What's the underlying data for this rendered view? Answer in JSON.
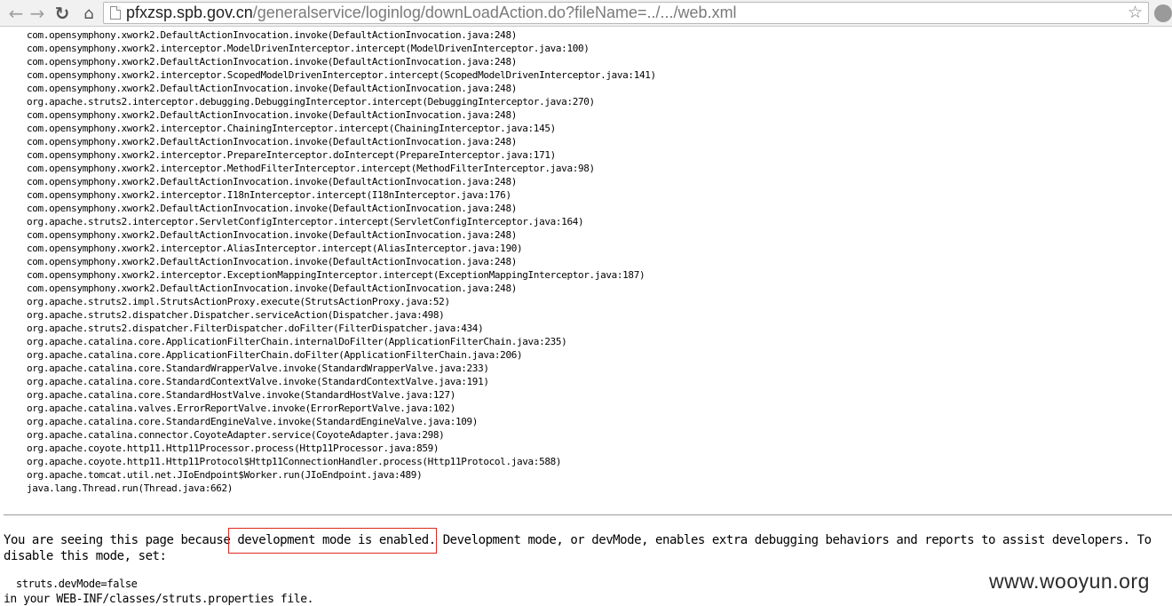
{
  "browser": {
    "url_host": "pfxzsp.spb.gov.cn",
    "url_path": "/generalservice/loginlog/downLoadAction.do?fileName=../.../web.xml"
  },
  "stack_trace": [
    "com.opensymphony.xwork2.DefaultActionInvocation.invoke(DefaultActionInvocation.java:248)",
    "com.opensymphony.xwork2.interceptor.ModelDrivenInterceptor.intercept(ModelDrivenInterceptor.java:100)",
    "com.opensymphony.xwork2.DefaultActionInvocation.invoke(DefaultActionInvocation.java:248)",
    "com.opensymphony.xwork2.interceptor.ScopedModelDrivenInterceptor.intercept(ScopedModelDrivenInterceptor.java:141)",
    "com.opensymphony.xwork2.DefaultActionInvocation.invoke(DefaultActionInvocation.java:248)",
    "org.apache.struts2.interceptor.debugging.DebuggingInterceptor.intercept(DebuggingInterceptor.java:270)",
    "com.opensymphony.xwork2.DefaultActionInvocation.invoke(DefaultActionInvocation.java:248)",
    "com.opensymphony.xwork2.interceptor.ChainingInterceptor.intercept(ChainingInterceptor.java:145)",
    "com.opensymphony.xwork2.DefaultActionInvocation.invoke(DefaultActionInvocation.java:248)",
    "com.opensymphony.xwork2.interceptor.PrepareInterceptor.doIntercept(PrepareInterceptor.java:171)",
    "com.opensymphony.xwork2.interceptor.MethodFilterInterceptor.intercept(MethodFilterInterceptor.java:98)",
    "com.opensymphony.xwork2.DefaultActionInvocation.invoke(DefaultActionInvocation.java:248)",
    "com.opensymphony.xwork2.interceptor.I18nInterceptor.intercept(I18nInterceptor.java:176)",
    "com.opensymphony.xwork2.DefaultActionInvocation.invoke(DefaultActionInvocation.java:248)",
    "org.apache.struts2.interceptor.ServletConfigInterceptor.intercept(ServletConfigInterceptor.java:164)",
    "com.opensymphony.xwork2.DefaultActionInvocation.invoke(DefaultActionInvocation.java:248)",
    "com.opensymphony.xwork2.interceptor.AliasInterceptor.intercept(AliasInterceptor.java:190)",
    "com.opensymphony.xwork2.DefaultActionInvocation.invoke(DefaultActionInvocation.java:248)",
    "com.opensymphony.xwork2.interceptor.ExceptionMappingInterceptor.intercept(ExceptionMappingInterceptor.java:187)",
    "com.opensymphony.xwork2.DefaultActionInvocation.invoke(DefaultActionInvocation.java:248)",
    "org.apache.struts2.impl.StrutsActionProxy.execute(StrutsActionProxy.java:52)",
    "org.apache.struts2.dispatcher.Dispatcher.serviceAction(Dispatcher.java:498)",
    "org.apache.struts2.dispatcher.FilterDispatcher.doFilter(FilterDispatcher.java:434)",
    "org.apache.catalina.core.ApplicationFilterChain.internalDoFilter(ApplicationFilterChain.java:235)",
    "org.apache.catalina.core.ApplicationFilterChain.doFilter(ApplicationFilterChain.java:206)",
    "org.apache.catalina.core.StandardWrapperValve.invoke(StandardWrapperValve.java:233)",
    "org.apache.catalina.core.StandardContextValve.invoke(StandardContextValve.java:191)",
    "org.apache.catalina.core.StandardHostValve.invoke(StandardHostValve.java:127)",
    "org.apache.catalina.valves.ErrorReportValve.invoke(ErrorReportValve.java:102)",
    "org.apache.catalina.core.StandardEngineValve.invoke(StandardEngineValve.java:109)",
    "org.apache.catalina.connector.CoyoteAdapter.service(CoyoteAdapter.java:298)",
    "org.apache.coyote.http11.Http11Processor.process(Http11Processor.java:859)",
    "org.apache.coyote.http11.Http11Protocol$Http11ConnectionHandler.process(Http11Protocol.java:588)",
    "org.apache.tomcat.util.net.JIoEndpoint$Worker.run(JIoEndpoint.java:489)",
    "java.lang.Thread.run(Thread.java:662)"
  ],
  "devmode_notice": {
    "before": "You are seeing this page because ",
    "highlight": "development mode is enabled.",
    "after": " Development mode, or devMode, enables extra debugging behaviors and reports to assist developers. To disable this mode, set:",
    "setting": "struts.devMode=false",
    "footer": "in your WEB-INF/classes/struts.properties file."
  },
  "watermark": "www.wooyun.org",
  "colors": {
    "highlight_border": "#e0281e"
  }
}
